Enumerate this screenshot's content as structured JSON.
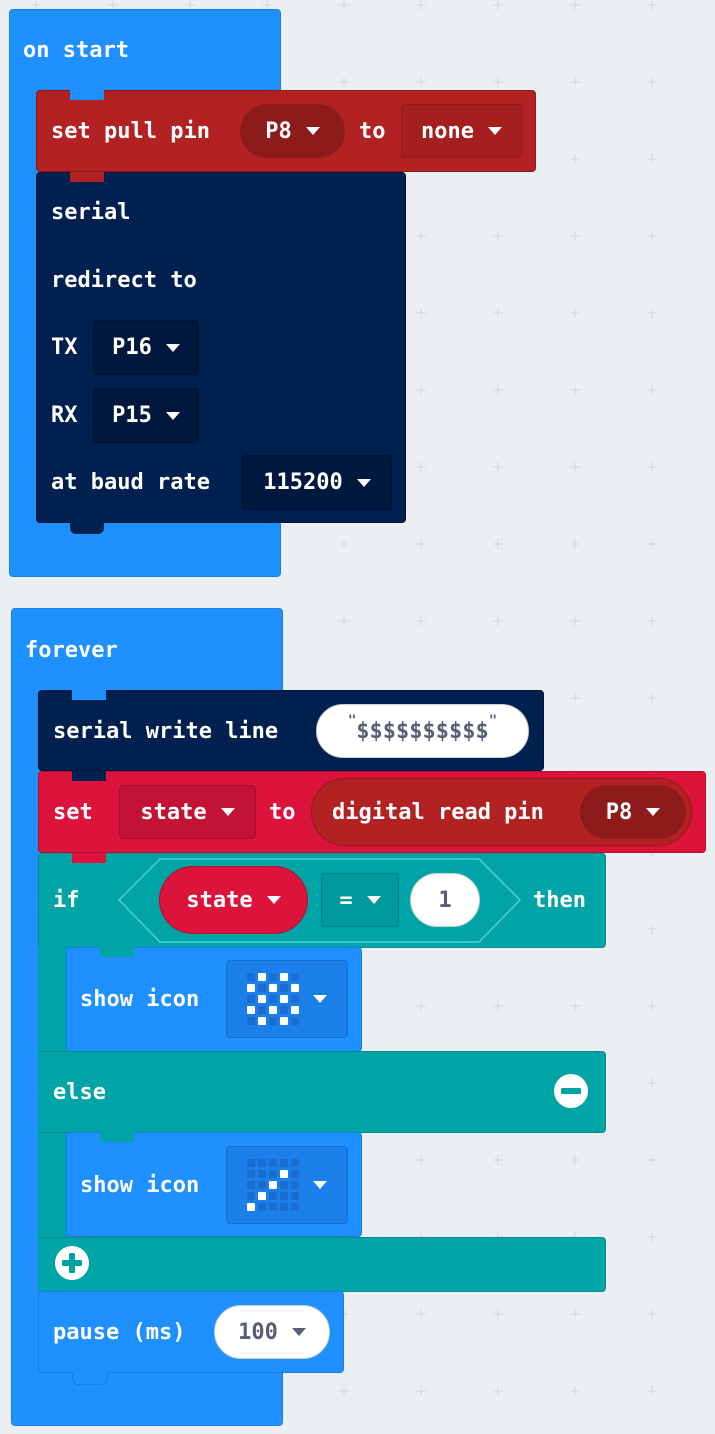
{
  "on_start": {
    "label": "on start",
    "pull": {
      "prefix": "set pull pin",
      "pin": "P8",
      "to": "to",
      "mode": "none"
    },
    "serial": {
      "line1": "serial",
      "line2": "redirect to",
      "tx_label": "TX",
      "tx_value": "P16",
      "rx_label": "RX",
      "rx_value": "P15",
      "baud_label": "at baud rate",
      "baud_value": "115200"
    }
  },
  "forever": {
    "label": "forever",
    "write": {
      "label": "serial write line",
      "value": "$$$$$$$$$$"
    },
    "set": {
      "label": "set",
      "variable": "state",
      "to": "to",
      "reader": "digital read pin",
      "pin": "P8"
    },
    "if": {
      "if_label": "if",
      "variable": "state",
      "operator": "=",
      "value": "1",
      "then_label": "then",
      "then_icon": {
        "label": "show icon",
        "pattern": [
          0,
          1,
          0,
          1,
          0,
          1,
          0,
          1,
          0,
          1,
          0,
          1,
          0,
          1,
          0,
          1,
          0,
          1,
          0,
          1,
          0,
          1,
          0,
          1,
          0
        ]
      },
      "else_label": "else",
      "else_icon": {
        "label": "show icon",
        "pattern": [
          0,
          0,
          0,
          0,
          0,
          0,
          0,
          0,
          1,
          0,
          0,
          0,
          1,
          0,
          0,
          0,
          1,
          0,
          0,
          0,
          1,
          0,
          0,
          0,
          0
        ]
      }
    },
    "pause": {
      "label": "pause (ms)",
      "value": "100"
    }
  },
  "colors": {
    "events": "#1e90ff",
    "pins": "#b22222",
    "serial": "#002050",
    "variables": "#dc143c",
    "logic": "#00a4a6",
    "basic": "#1e90ff",
    "led_on": "#ffffff",
    "led_off": "#1a6cd1"
  }
}
